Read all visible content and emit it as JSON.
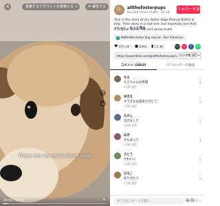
{
  "video": {
    "search_text": "探索するアカウントを検索する",
    "search_icon": "search-icon",
    "report_label": "報告する",
    "caption": "These are my senior foster dogs",
    "time": "00:02 / 00:47",
    "progress": 0.05
  },
  "author": {
    "username": "allthefosterpups",
    "sub": "foo and senior mutts · 10-10",
    "follow_label": "フォローする"
  },
  "description": {
    "text": "This is the story of my foster dogs Peanut Butter & Jelly. Their story is a sad one, but hopefully one that will ecc...",
    "more_label": "もっと見る"
  },
  "sound": "♫ original sound - foo and senior mutts",
  "chip": "Moffolitte foster dog rescue · San Francisco",
  "stats": {
    "likes": "475.1K",
    "comments": "2461",
    "saves": "13.3K"
  },
  "link": {
    "url": "https://www.tiktok.com/@allthefosterpups/video/...",
    "copy_label": "リンクをコピー"
  },
  "tabs": [
    {
      "label": "コメント (2463)"
    },
    {
      "label": "クリエイターの動画"
    }
  ],
  "comments": [
    {
      "name": "ちえ",
      "text": "ちえちゃんの笑顔",
      "meta": "2日前 返信",
      "likes": "4"
    },
    {
      "name": "ゆきえ",
      "text": "すてきなお話ありがとう",
      "meta": "2日前 返信",
      "likes": "2"
    },
    {
      "name": "たけし",
      "text": "泣けました",
      "meta": "2日前 返信",
      "likes": "1"
    },
    {
      "name": "みき",
      "text": "がんばって",
      "meta": "2日前 返信",
      "likes": "1"
    },
    {
      "name": "さとう",
      "text": "かわいい",
      "meta": "2日前 返信",
      "likes": "1"
    },
    {
      "name": "ひろこ",
      "text": "ありがとう",
      "meta": "2日前 返信",
      "likes": "2"
    }
  ],
  "footer": {
    "placeholder": "すてきなコメントを書く...",
    "post_label": "投稿する"
  },
  "colors": {
    "accent": "#fe2c55",
    "text": "#161823",
    "muted": "#6d6e74"
  }
}
